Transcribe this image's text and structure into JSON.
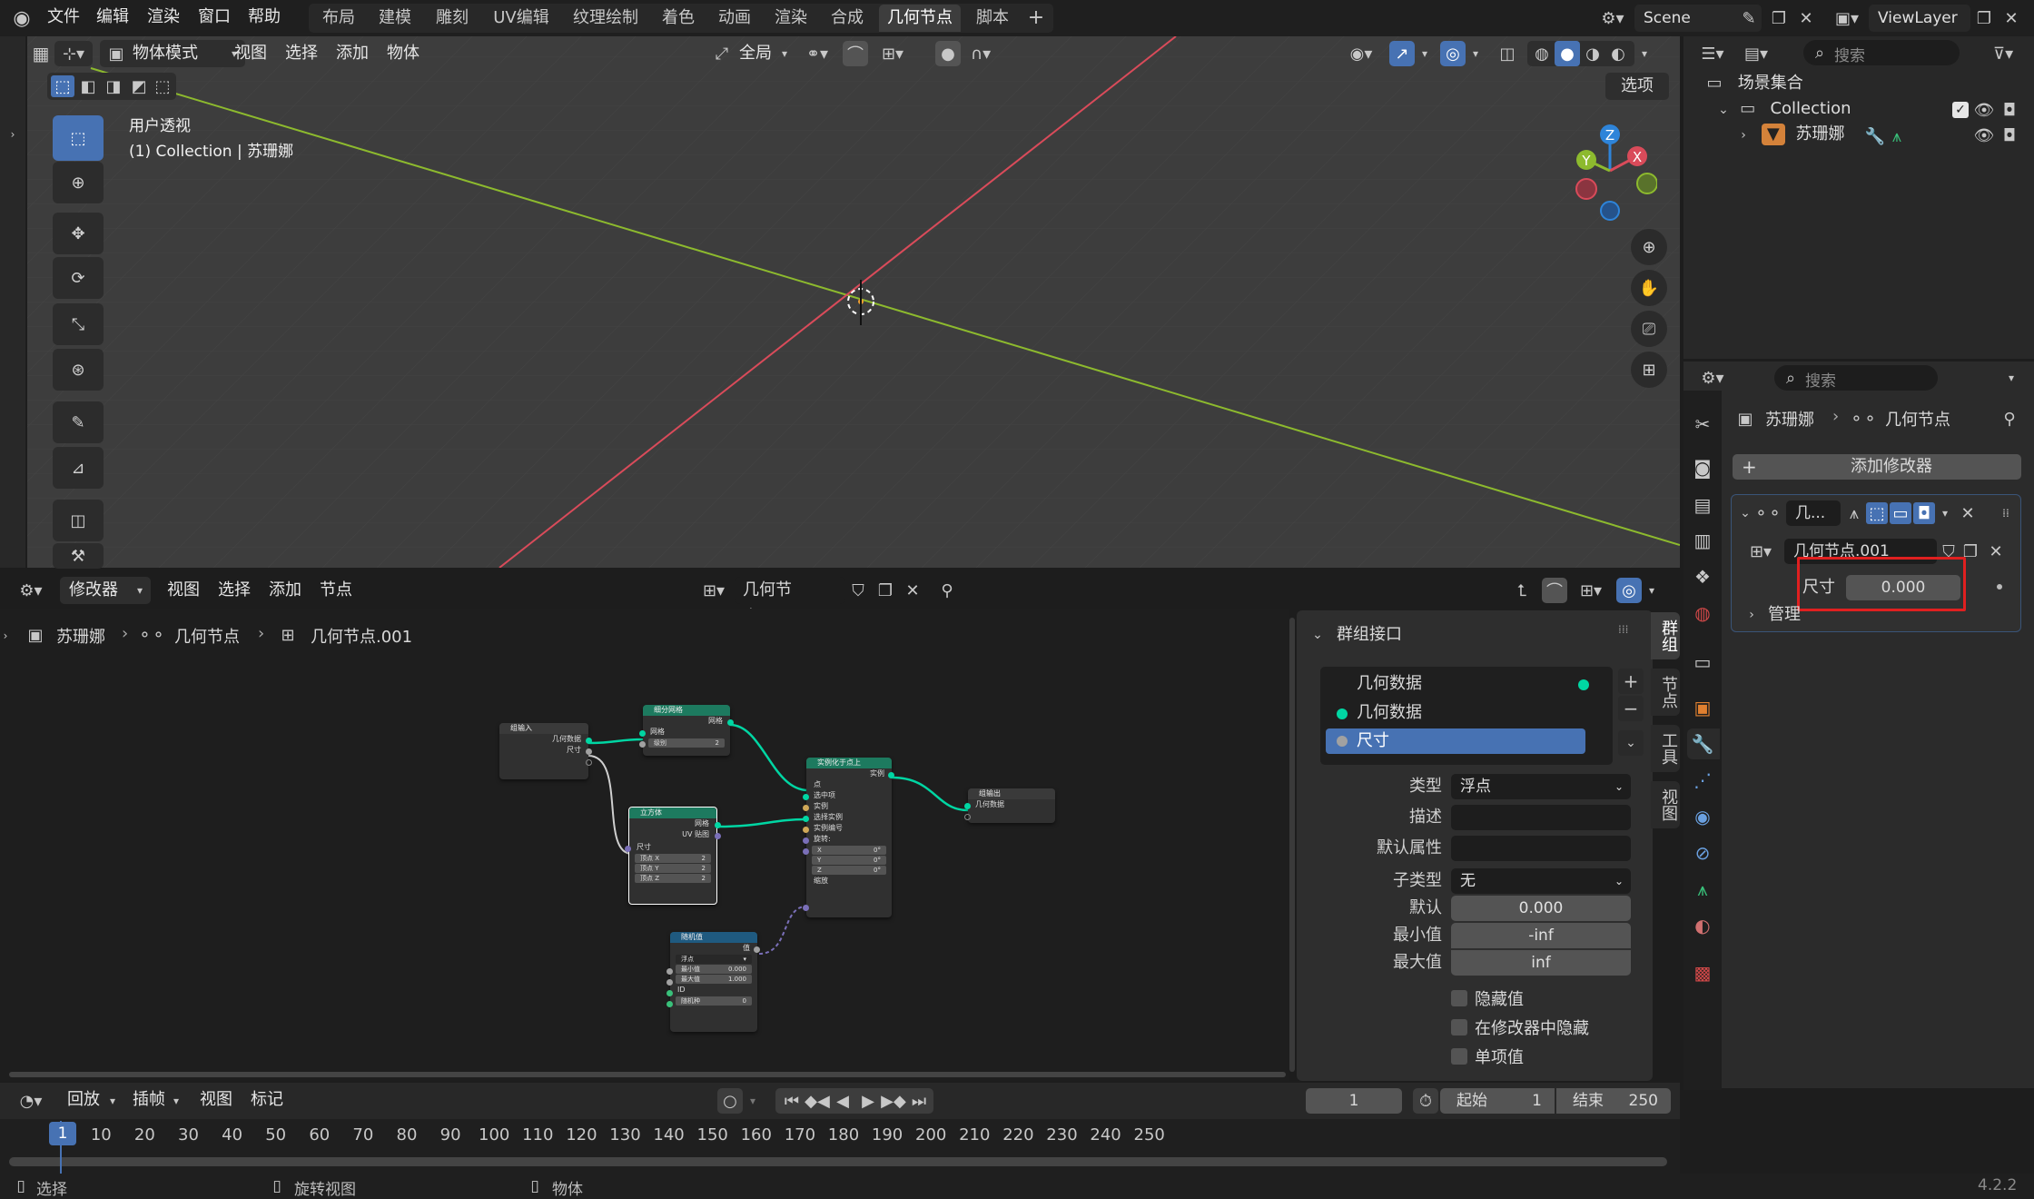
{
  "topbar": {
    "menus": [
      "文件",
      "编辑",
      "渲染",
      "窗口",
      "帮助"
    ],
    "workspaces": [
      "布局",
      "建模",
      "雕刻",
      "UV编辑",
      "纹理绘制",
      "着色",
      "动画",
      "渲染",
      "合成",
      "几何节点",
      "脚本"
    ],
    "active_workspace": "几何节点",
    "add_tab": "+",
    "scene": "Scene",
    "view_layer": "ViewLayer"
  },
  "viewport": {
    "mode": "物体模式",
    "menus": [
      "视图",
      "选择",
      "添加",
      "物体"
    ],
    "transform_orientation": "全局",
    "options_label": "选项",
    "overlay_title": "用户透视",
    "overlay_subtitle": "(1) Collection | 苏珊娜",
    "gizmo_axes": {
      "x": "X",
      "y": "Y",
      "z": "Z"
    },
    "colors": {
      "x_axis": "#d94b5a",
      "y_axis": "#8dba2e",
      "z_axis": "#2e84d9"
    }
  },
  "outliner": {
    "search_placeholder": "搜索",
    "root": "场景集合",
    "collection": "Collection",
    "object": "苏珊娜"
  },
  "properties": {
    "search_placeholder": "搜索",
    "breadcrumb_object": "苏珊娜",
    "breadcrumb_modifier": "几何节点",
    "add_modifier": "添加修改器",
    "modifier_name": "几...",
    "node_group": "几何节点.001",
    "size_label": "尺寸",
    "size_value": "0.000",
    "manage_label": "管理"
  },
  "node_editor": {
    "editor_type": "修改器",
    "menus": [
      "视图",
      "选择",
      "添加",
      "节点"
    ],
    "node_group": "几何节点.001",
    "breadcrumb": [
      "苏珊娜",
      "几何节点",
      "几何节点.001"
    ],
    "nodes": {
      "group_input": {
        "title": "组输入",
        "outputs": [
          "几何数据",
          "尺寸"
        ]
      },
      "subdivide": {
        "title": "细分网格",
        "out": "网格",
        "in": "网格",
        "level": "级别",
        "level_val": "2"
      },
      "cube": {
        "title": "立方体",
        "outs": [
          "网格",
          "UV 贴图"
        ],
        "size": "尺寸",
        "fields": [
          "顶点 X",
          "顶点 Y",
          "顶点 Z"
        ],
        "field_vals": [
          "2",
          "2",
          "2"
        ]
      },
      "instance": {
        "title": "实例化于点上",
        "out": "实例",
        "ins": [
          "点",
          "选中项",
          "实例",
          "选择实例",
          "实例编号",
          "旋转:"
        ],
        "rot": [
          "X",
          "Y",
          "Z"
        ],
        "rot_vals": [
          "0°",
          "0°",
          "0°"
        ],
        "scale": "缩放"
      },
      "group_output": {
        "title": "组输出",
        "in": "几何数据"
      },
      "random": {
        "title": "随机值",
        "out": "值",
        "type": "浮点",
        "min": "最小值",
        "min_val": "0.000",
        "max": "最大值",
        "max_val": "1.000",
        "id": "ID",
        "seed": "随机种",
        "seed_val": "0"
      }
    }
  },
  "group_panel": {
    "title": "群组接口",
    "items": [
      "几何数据",
      "几何数据",
      "尺寸"
    ],
    "type_label": "类型",
    "type_value": "浮点",
    "desc_label": "描述",
    "default_attr_label": "默认属性",
    "subtype_label": "子类型",
    "subtype_value": "无",
    "default_label": "默认",
    "default_value": "0.000",
    "min_label": "最小值",
    "min_value": "-inf",
    "max_label": "最大值",
    "max_value": "inf",
    "hide_value": "隐藏值",
    "hide_in_modifier": "在修改器中隐藏",
    "single_value": "单项值",
    "tabs": [
      "群组",
      "节点",
      "工具",
      "视图"
    ]
  },
  "timeline": {
    "menus": [
      "回放",
      "插帧",
      "视图",
      "标记"
    ],
    "current_frame": "1",
    "start_label": "起始",
    "start_value": "1",
    "end_label": "结束",
    "end_value": "250",
    "ticks": [
      "1",
      "10",
      "20",
      "30",
      "40",
      "50",
      "60",
      "70",
      "80",
      "90",
      "100",
      "110",
      "120",
      "130",
      "140",
      "150",
      "160",
      "170",
      "180",
      "190",
      "200",
      "210",
      "220",
      "230",
      "240",
      "250"
    ]
  },
  "statusbar": {
    "select": "选择",
    "rotate_view": "旋转视图",
    "object": "物体",
    "version": "4.2.2"
  }
}
